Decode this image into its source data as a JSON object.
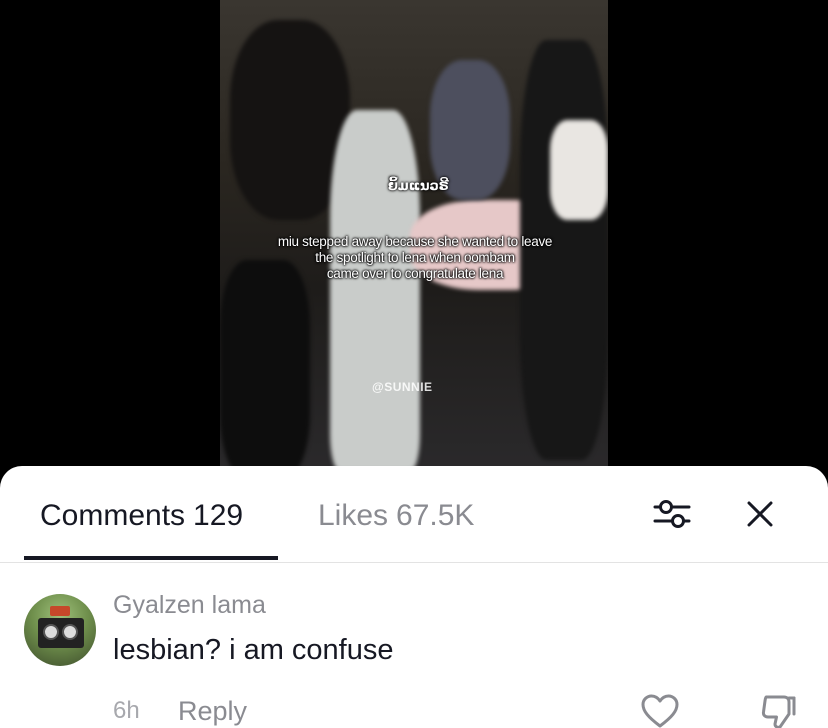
{
  "video": {
    "brand_overlay": "ຍິ້ມແນວຣີ",
    "caption_lines": [
      "miu stepped away because she wanted to leave",
      "the spotlight to lena when oombam",
      "came over to congratulate lena"
    ],
    "watermark": "@SUNNIE"
  },
  "tabs": [
    {
      "label": "Comments",
      "count": "129",
      "active": true
    },
    {
      "label": "Likes",
      "count": "67.5K",
      "active": false
    }
  ],
  "header_icons": {
    "filter": "sliders-icon",
    "close": "close-icon"
  },
  "comments": [
    {
      "username": "Gyalzen lama",
      "text": "lesbian? i am confuse",
      "time": "6h",
      "reply_label": "Reply",
      "like_icon": "heart-outline-icon",
      "dislike_icon": "thumbs-down-icon"
    }
  ],
  "colors": {
    "primary_text": "#161823",
    "secondary_text": "#8a8b91",
    "divider": "#e3e3e3",
    "sheet_bg": "#ffffff"
  }
}
